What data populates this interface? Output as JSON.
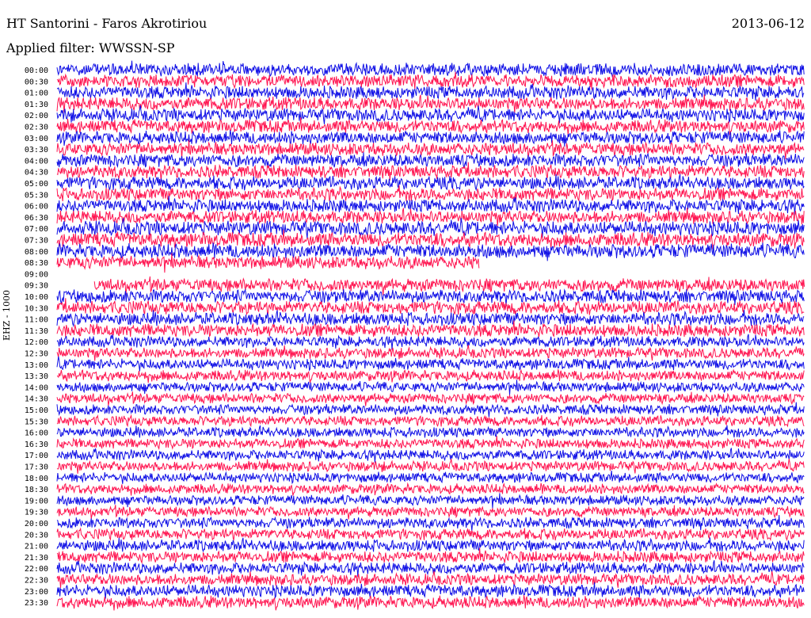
{
  "header": {
    "station": "HT Santorini - Faros Akrotiriou",
    "date": "2013-06-12",
    "filter_label": "Applied filter: WWSSN-SP"
  },
  "axis": {
    "channel_label": "EHZ - 1000"
  },
  "colors": {
    "trace_a": "#1010e6",
    "trace_b": "#ff1450",
    "background": "#ffffff",
    "text": "#000000"
  },
  "chart_data": {
    "type": "line",
    "subtype": "helicorder",
    "title": "HT Santorini - Faros Akrotiriou",
    "date": "2013-06-12",
    "ylabel": "EHZ - 1000",
    "x_range_minutes": [
      0,
      30
    ],
    "rows": [
      {
        "label": "00:00",
        "color": "blue",
        "amplitude": 0.9,
        "start_fraction": 0.0,
        "end_fraction": 1.0
      },
      {
        "label": "00:30",
        "color": "red",
        "amplitude": 0.9,
        "start_fraction": 0.0,
        "end_fraction": 1.0
      },
      {
        "label": "01:00",
        "color": "blue",
        "amplitude": 0.9,
        "start_fraction": 0.0,
        "end_fraction": 1.0
      },
      {
        "label": "01:30",
        "color": "red",
        "amplitude": 0.9,
        "start_fraction": 0.0,
        "end_fraction": 1.0
      },
      {
        "label": "02:00",
        "color": "blue",
        "amplitude": 0.9,
        "start_fraction": 0.0,
        "end_fraction": 1.0
      },
      {
        "label": "02:30",
        "color": "red",
        "amplitude": 0.9,
        "start_fraction": 0.0,
        "end_fraction": 1.0
      },
      {
        "label": "03:00",
        "color": "blue",
        "amplitude": 0.9,
        "start_fraction": 0.0,
        "end_fraction": 1.0
      },
      {
        "label": "03:30",
        "color": "red",
        "amplitude": 0.9,
        "start_fraction": 0.0,
        "end_fraction": 1.0
      },
      {
        "label": "04:00",
        "color": "blue",
        "amplitude": 0.9,
        "start_fraction": 0.0,
        "end_fraction": 1.0
      },
      {
        "label": "04:30",
        "color": "red",
        "amplitude": 0.9,
        "start_fraction": 0.0,
        "end_fraction": 1.0
      },
      {
        "label": "05:00",
        "color": "blue",
        "amplitude": 0.9,
        "start_fraction": 0.0,
        "end_fraction": 1.0
      },
      {
        "label": "05:30",
        "color": "red",
        "amplitude": 0.9,
        "start_fraction": 0.0,
        "end_fraction": 1.0
      },
      {
        "label": "06:00",
        "color": "blue",
        "amplitude": 0.9,
        "start_fraction": 0.0,
        "end_fraction": 1.0
      },
      {
        "label": "06:30",
        "color": "red",
        "amplitude": 0.9,
        "start_fraction": 0.0,
        "end_fraction": 1.0
      },
      {
        "label": "07:00",
        "color": "blue",
        "amplitude": 1.0,
        "start_fraction": 0.0,
        "end_fraction": 1.0
      },
      {
        "label": "07:30",
        "color": "red",
        "amplitude": 1.0,
        "start_fraction": 0.0,
        "end_fraction": 1.0
      },
      {
        "label": "08:00",
        "color": "blue",
        "amplitude": 1.0,
        "start_fraction": 0.0,
        "end_fraction": 1.0
      },
      {
        "label": "08:30",
        "color": "red",
        "amplitude": 0.9,
        "start_fraction": 0.0,
        "end_fraction": 0.565
      },
      {
        "label": "09:00",
        "color": "blue",
        "amplitude": 0.0,
        "start_fraction": 0.0,
        "end_fraction": 0.0
      },
      {
        "label": "09:30",
        "color": "red",
        "amplitude": 0.9,
        "start_fraction": 0.05,
        "end_fraction": 1.0
      },
      {
        "label": "10:00",
        "color": "blue",
        "amplitude": 0.9,
        "start_fraction": 0.0,
        "end_fraction": 1.0
      },
      {
        "label": "10:30",
        "color": "red",
        "amplitude": 0.9,
        "start_fraction": 0.0,
        "end_fraction": 1.0
      },
      {
        "label": "11:00",
        "color": "blue",
        "amplitude": 0.9,
        "start_fraction": 0.0,
        "end_fraction": 1.0
      },
      {
        "label": "11:30",
        "color": "red",
        "amplitude": 0.9,
        "start_fraction": 0.0,
        "end_fraction": 1.0
      },
      {
        "label": "12:00",
        "color": "blue",
        "amplitude": 0.75,
        "start_fraction": 0.0,
        "end_fraction": 1.0
      },
      {
        "label": "12:30",
        "color": "red",
        "amplitude": 0.75,
        "start_fraction": 0.0,
        "end_fraction": 1.0
      },
      {
        "label": "13:00",
        "color": "blue",
        "amplitude": 0.75,
        "start_fraction": 0.0,
        "end_fraction": 1.0
      },
      {
        "label": "13:30",
        "color": "red",
        "amplitude": 0.75,
        "start_fraction": 0.0,
        "end_fraction": 1.0
      },
      {
        "label": "14:00",
        "color": "blue",
        "amplitude": 0.7,
        "start_fraction": 0.0,
        "end_fraction": 1.0
      },
      {
        "label": "14:30",
        "color": "red",
        "amplitude": 0.7,
        "start_fraction": 0.0,
        "end_fraction": 1.0
      },
      {
        "label": "15:00",
        "color": "blue",
        "amplitude": 0.7,
        "start_fraction": 0.0,
        "end_fraction": 1.0
      },
      {
        "label": "15:30",
        "color": "red",
        "amplitude": 0.7,
        "start_fraction": 0.0,
        "end_fraction": 1.0
      },
      {
        "label": "16:00",
        "color": "blue",
        "amplitude": 0.7,
        "start_fraction": 0.0,
        "end_fraction": 1.0
      },
      {
        "label": "16:30",
        "color": "red",
        "amplitude": 0.7,
        "start_fraction": 0.0,
        "end_fraction": 1.0
      },
      {
        "label": "17:00",
        "color": "blue",
        "amplitude": 0.7,
        "start_fraction": 0.0,
        "end_fraction": 1.0
      },
      {
        "label": "17:30",
        "color": "red",
        "amplitude": 0.7,
        "start_fraction": 0.0,
        "end_fraction": 1.0
      },
      {
        "label": "18:00",
        "color": "blue",
        "amplitude": 0.7,
        "start_fraction": 0.0,
        "end_fraction": 1.0
      },
      {
        "label": "18:30",
        "color": "red",
        "amplitude": 0.7,
        "start_fraction": 0.0,
        "end_fraction": 1.0
      },
      {
        "label": "19:00",
        "color": "blue",
        "amplitude": 0.7,
        "start_fraction": 0.0,
        "end_fraction": 1.0
      },
      {
        "label": "19:30",
        "color": "red",
        "amplitude": 0.7,
        "start_fraction": 0.0,
        "end_fraction": 1.0
      },
      {
        "label": "20:00",
        "color": "blue",
        "amplitude": 0.75,
        "start_fraction": 0.0,
        "end_fraction": 1.0
      },
      {
        "label": "20:30",
        "color": "red",
        "amplitude": 0.75,
        "start_fraction": 0.0,
        "end_fraction": 1.0
      },
      {
        "label": "21:00",
        "color": "blue",
        "amplitude": 0.8,
        "start_fraction": 0.0,
        "end_fraction": 1.0
      },
      {
        "label": "21:30",
        "color": "red",
        "amplitude": 0.8,
        "start_fraction": 0.0,
        "end_fraction": 1.0
      },
      {
        "label": "22:00",
        "color": "blue",
        "amplitude": 0.8,
        "start_fraction": 0.0,
        "end_fraction": 1.0
      },
      {
        "label": "22:30",
        "color": "red",
        "amplitude": 0.8,
        "start_fraction": 0.0,
        "end_fraction": 1.0
      },
      {
        "label": "23:00",
        "color": "blue",
        "amplitude": 0.85,
        "start_fraction": 0.0,
        "end_fraction": 1.0
      },
      {
        "label": "23:30",
        "color": "red",
        "amplitude": 0.85,
        "start_fraction": 0.0,
        "end_fraction": 1.0
      }
    ]
  }
}
